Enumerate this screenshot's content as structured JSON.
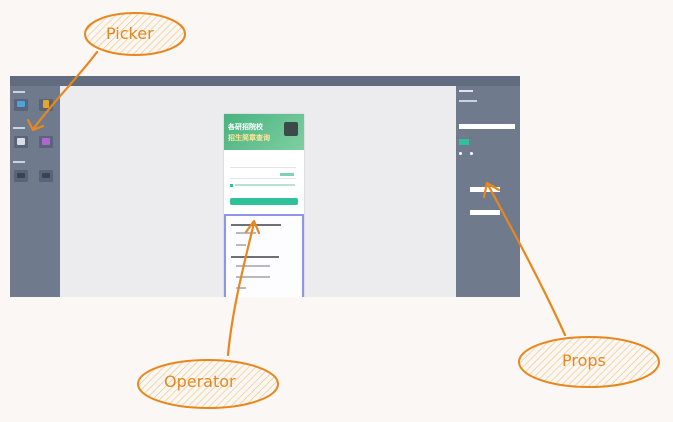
{
  "labels": {
    "picker": "Picker",
    "operator": "Operator",
    "props": "Props"
  },
  "colors": {
    "annotation": "#e8871e",
    "bubble_fill": "#f8e7c7",
    "panel": "#6f7a8c",
    "canvas": "#ececef",
    "banner_green": "#49b27f",
    "selection_border": "#8e95e8",
    "submit_button": "#2fc29a"
  },
  "screenshot": {
    "banner_line1": "各研招院校",
    "banner_line2": "招生简章查询"
  }
}
